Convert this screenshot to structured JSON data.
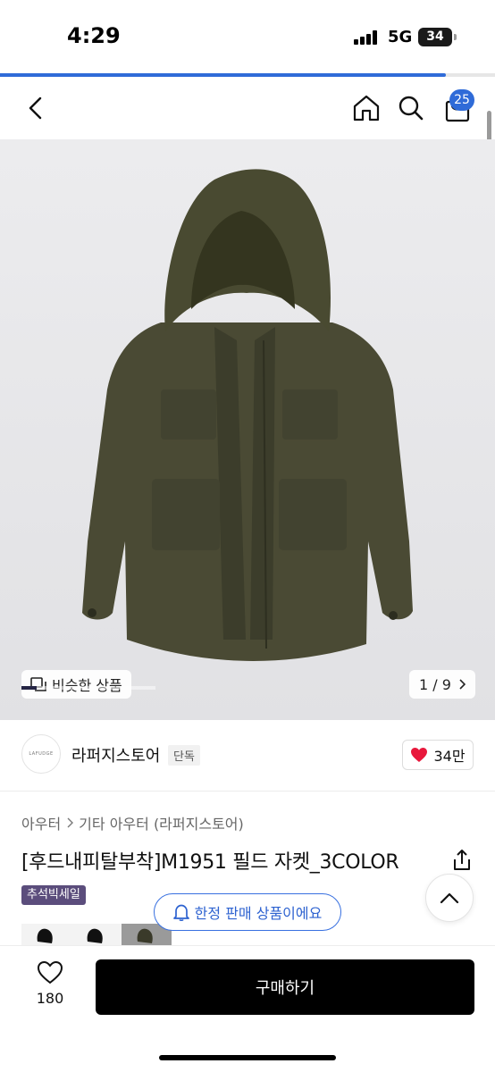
{
  "status_bar": {
    "time": "4:29",
    "network": "5G",
    "battery": "34"
  },
  "page_load_progress": 0.9,
  "header": {
    "cart_count": "25"
  },
  "gallery": {
    "similar_label": "비슷한 상품",
    "counter": "1 / 9",
    "progress_fraction": 0.111
  },
  "store": {
    "logo_text": "LAFUDGE",
    "name": "라퍼지스토어",
    "exclusive_badge": "단독",
    "likes": "34만"
  },
  "breadcrumb": {
    "category": "아우터",
    "subcategory": "기타 아우터 (라퍼지스토어)"
  },
  "product": {
    "title": "[후드내피탈부착]M1951 필드 자켓_3COLOR",
    "sale_tag": "추석빅세일"
  },
  "notice": {
    "limited_label": "한정 판매 상품이에요"
  },
  "bottom_bar": {
    "wish_count": "180",
    "buy_label": "구매하기"
  },
  "colors": {
    "accent_blue": "#2f6bd8",
    "sale_purple": "#5b4d7c",
    "jacket_olive": "#4a4a34",
    "heart_red": "#e8173b"
  }
}
